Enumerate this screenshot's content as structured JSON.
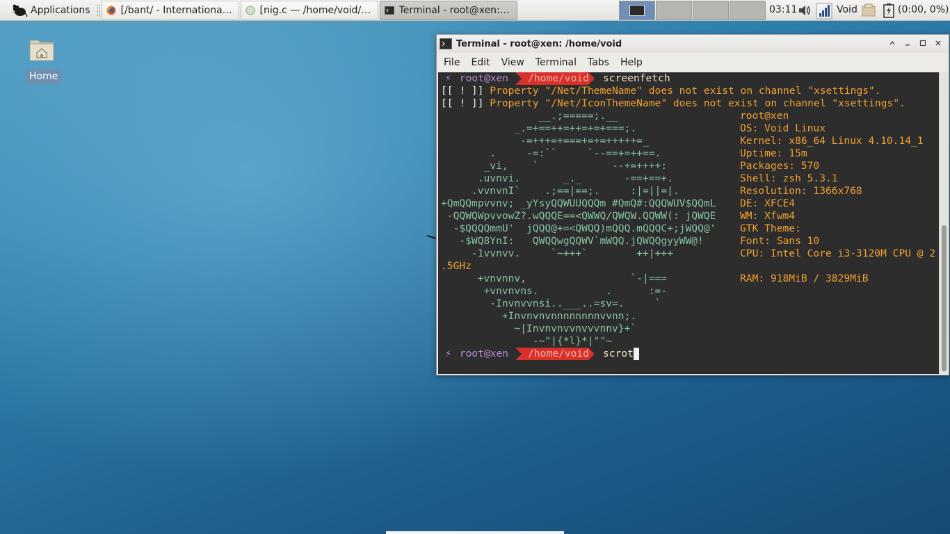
{
  "panel": {
    "applications_label": "Applications",
    "tasks": [
      {
        "label": "[/bant/ - International/Ra...",
        "icon": "firefox-icon"
      },
      {
        "label": "[nig.c — /home/void/Dow...",
        "icon": "editor-icon"
      },
      {
        "label": "Terminal - root@xen: /ho...",
        "icon": "terminal-icon"
      }
    ],
    "clock": "03:11",
    "user_label": "Void",
    "battery_label": "(0:00, 0%)"
  },
  "desktop": {
    "home_label": "Home"
  },
  "terminal": {
    "title": "Terminal - root@xen: /home/void",
    "menu": [
      "File",
      "Edit",
      "View",
      "Terminal",
      "Tabs",
      "Help"
    ],
    "prompt": {
      "bolt": "⚡",
      "user": "root@xen",
      "path": "/home/void",
      "first_cmd": "screenfetch",
      "last_cmd": "scrot"
    },
    "warnings": [
      {
        "bracket": "[[ ! ]]",
        "text": " Property \"/Net/ThemeName\" does not exist on channel \"xsettings\"."
      },
      {
        "bracket": "[[ ! ]]",
        "text": " Property \"/Net/IconThemeName\" does not exist on channel \"xsettings\"."
      }
    ],
    "art_lines": [
      "                __.;=====;.__",
      "            _.=+==++=++=+=+===;.",
      "             -=+++=+===+=+=+++++=_",
      "        .     -=:``     `--==+=++==.",
      "       _vi,    `            --+=++++:",
      "      .uvnvi.       _._       -==+==+.",
      "     .vvnvnI`    .;==|==;.     :|=||=|.",
      "+QmQQmpvvnv; _yYsyQQWUUQQQm #QmQ#:QQQWUV$QQmL",
      " -QQWQWpvvowZ?.wQQQE==<QWWQ/QWQW.QQWW(: jQWQE",
      "  -$QQQQmmU'  jQQQ@+=<QWQQ)mQQQ.mQQQC+;jWQQ@'",
      "   -$WQ8YnI:   QWQQwgQQWV`mWQQ.jQWQQgyyWW@!",
      "     -1vvnvv.     `~+++`        ++|+++",
      "",
      "      +vnvnnv,                 `-|===",
      "       +vnvnvns.           .      :=-",
      "        -Invnvvnsi..___..=sv=.     `",
      "          +Invnvnvnnnnnnnnvvnn;.",
      "            ~|Invnvnvvnvvvnnv}+`",
      "               -~\"|{*l}*|\"\"~"
    ],
    "info": {
      "user": "root@xen",
      "rows": [
        "OS: Void Linux",
        "Kernel: x86_64 Linux 4.10.14_1",
        "Uptime: 15m",
        "Packages: 570",
        "Shell: zsh 5.3.1",
        "Resolution: 1366x768",
        "DE: XFCE4",
        "WM: Xfwm4",
        "GTK Theme:",
        "Font: Sans 10",
        "CPU: Intel Core i3-3120M CPU @ 2",
        "",
        "RAM: 918MiB / 3829MiB"
      ],
      "cpu_wrap": ".5GHz"
    }
  }
}
